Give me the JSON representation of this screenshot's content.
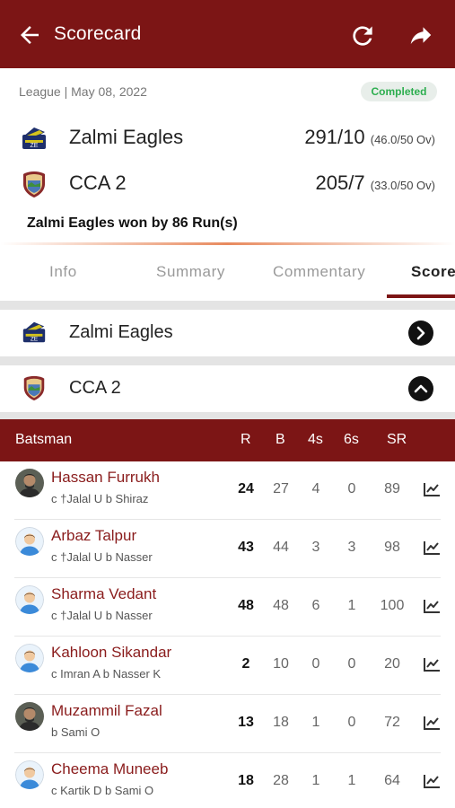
{
  "header": {
    "title": "Scorecard",
    "back_icon": "back-arrow-icon",
    "refresh_icon": "refresh-icon",
    "share_icon": "share-icon",
    "bar_color": "#7c1515"
  },
  "match": {
    "meta": "League | May 08, 2022",
    "status": "Completed",
    "teams": [
      {
        "name": "Zalmi Eagles",
        "score": "291/10",
        "overs": "(46.0/50 Ov)"
      },
      {
        "name": "CCA 2",
        "score": "205/7",
        "overs": "(33.0/50 Ov)"
      }
    ],
    "result": "Zalmi Eagles won by 86 Run(s)"
  },
  "tabs": [
    {
      "label": "Info"
    },
    {
      "label": "Summary"
    },
    {
      "label": "Commentary"
    },
    {
      "label": "Score"
    }
  ],
  "active_tab": "Score",
  "innings": [
    {
      "team": "Zalmi Eagles",
      "expanded": false
    },
    {
      "team": "CCA 2",
      "expanded": true
    }
  ],
  "batting": {
    "headers": {
      "batsman": "Batsman",
      "r": "R",
      "b": "B",
      "fours": "4s",
      "sixes": "6s",
      "sr": "SR"
    },
    "rows": [
      {
        "name": "Hassan Furrukh",
        "dismissal": "c †Jalal U b Shiraz",
        "r": "24",
        "b": "27",
        "fours": "4",
        "sixes": "0",
        "sr": "89"
      },
      {
        "name": "Arbaz Talpur",
        "dismissal": "c †Jalal U b Nasser",
        "r": "43",
        "b": "44",
        "fours": "3",
        "sixes": "3",
        "sr": "98"
      },
      {
        "name": "Sharma Vedant",
        "dismissal": "c †Jalal U b Nasser",
        "r": "48",
        "b": "48",
        "fours": "6",
        "sixes": "1",
        "sr": "100"
      },
      {
        "name": "Kahloon Sikandar",
        "dismissal": "c Imran A b Nasser K",
        "r": "2",
        "b": "10",
        "fours": "0",
        "sixes": "0",
        "sr": "20"
      },
      {
        "name": "Muzammil Fazal",
        "dismissal": "b Sami O",
        "r": "13",
        "b": "18",
        "fours": "1",
        "sixes": "0",
        "sr": "72"
      },
      {
        "name": "Cheema Muneeb",
        "dismissal": "c Kartik D b Sami O",
        "r": "18",
        "b": "28",
        "fours": "1",
        "sixes": "1",
        "sr": "64"
      }
    ]
  }
}
